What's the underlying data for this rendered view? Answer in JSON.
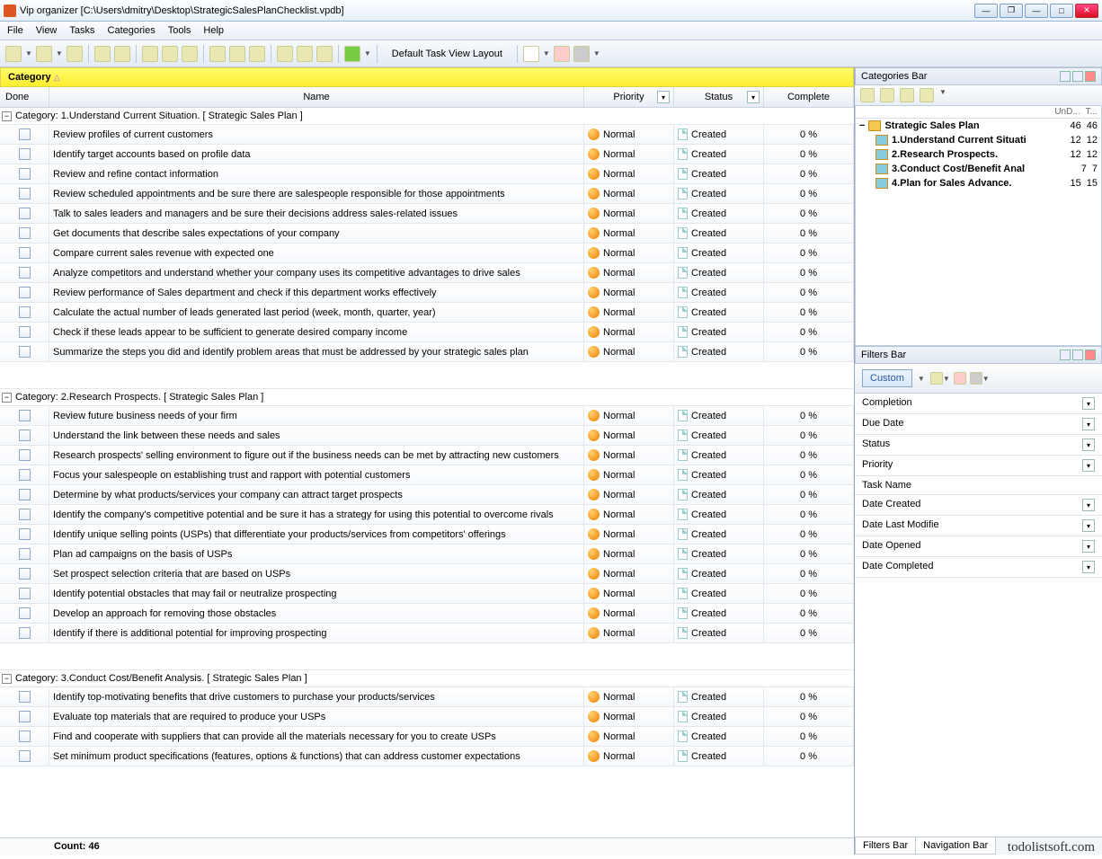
{
  "window": {
    "title": "Vip organizer [C:\\Users\\dmitry\\Desktop\\StrategicSalesPlanChecklist.vpdb]"
  },
  "menu": [
    "File",
    "View",
    "Tasks",
    "Categories",
    "Tools",
    "Help"
  ],
  "toolbar": {
    "layout_label": "Default Task View Layout"
  },
  "group_header": "Category",
  "columns": {
    "done": "Done",
    "name": "Name",
    "priority": "Priority",
    "status": "Status",
    "complete": "Complete"
  },
  "defaults": {
    "priority": "Normal",
    "status": "Created",
    "complete": "0 %"
  },
  "groups": [
    {
      "title": "Category: 1.Understand Current Situation.    [ Strategic Sales Plan ]",
      "tasks": [
        "Review profiles of current customers",
        "Identify target accounts based on profile data",
        "Review and refine contact information",
        "Review scheduled appointments and be sure there are salespeople responsible for those appointments",
        "Talk to sales leaders and managers and be sure their decisions address sales-related issues",
        "Get documents that describe sales expectations of your company",
        "Compare current sales revenue with expected one",
        "Analyze competitors and understand whether your company uses its competitive advantages to drive sales",
        "Review performance of Sales department and check if this department works effectively",
        "Calculate the actual number of leads generated last period (week, month, quarter, year)",
        "Check if these leads appear to be sufficient to generate desired company income",
        "Summarize the steps you did and identify problem areas that must be addressed by your strategic sales plan"
      ]
    },
    {
      "title": "Category: 2.Research Prospects.    [ Strategic Sales Plan  ]",
      "tasks": [
        "Review future business needs of your firm",
        "Understand the link between these needs and sales",
        "Research prospects' selling environment to figure out if the business needs can be met by attracting new customers",
        "Focus your salespeople on establishing trust and rapport with potential customers",
        "Determine by what products/services your company can attract target prospects",
        "Identify the company's competitive potential and be sure it has a strategy for using this potential to overcome rivals",
        "Identify unique selling points (USPs) that differentiate your products/services from competitors' offerings",
        "Plan ad campaigns on the basis of USPs",
        "Set prospect selection criteria that are based on USPs",
        "Identify potential obstacles that may fail or neutralize prospecting",
        "Develop an approach for removing those obstacles",
        "Identify if there is additional potential for improving prospecting"
      ]
    },
    {
      "title": "Category: 3.Conduct Cost/Benefit Analysis.    [ Strategic Sales Plan  ]",
      "tasks": [
        "Identify top-motivating benefits that drive customers to purchase your products/services",
        "Evaluate top materials that are required to produce your USPs",
        "Find and cooperate with suppliers that can provide all the materials necessary for you to create USPs",
        "Set minimum product specifications (features, options & functions) that can address customer expectations"
      ]
    }
  ],
  "footer": {
    "count": "Count:  46"
  },
  "categories_bar": {
    "title": "Categories Bar",
    "cols": {
      "undone": "UnD...",
      "total": "T..."
    },
    "items": [
      {
        "name": "Strategic Sales Plan",
        "a": "46",
        "b": "46",
        "root": true
      },
      {
        "name": "1.Understand Current Situati",
        "a": "12",
        "b": "12"
      },
      {
        "name": "2.Research Prospects.",
        "a": "12",
        "b": "12"
      },
      {
        "name": "3.Conduct Cost/Benefit Anal",
        "a": "7",
        "b": "7"
      },
      {
        "name": "4.Plan for Sales Advance.",
        "a": "15",
        "b": "15"
      }
    ]
  },
  "filters_bar": {
    "title": "Filters Bar",
    "custom": "Custom",
    "fields": [
      "Completion",
      "Due Date",
      "Status",
      "Priority",
      "Task Name",
      "Date Created",
      "Date Last Modifie",
      "Date Opened",
      "Date Completed"
    ],
    "dropdown_fields": [
      "Completion",
      "Due Date",
      "Status",
      "Priority",
      "Date Created",
      "Date Last Modifie",
      "Date Opened",
      "Date Completed"
    ]
  },
  "bottom_tabs": [
    "Filters Bar",
    "Navigation Bar"
  ],
  "watermark": "todolistsoft.com"
}
